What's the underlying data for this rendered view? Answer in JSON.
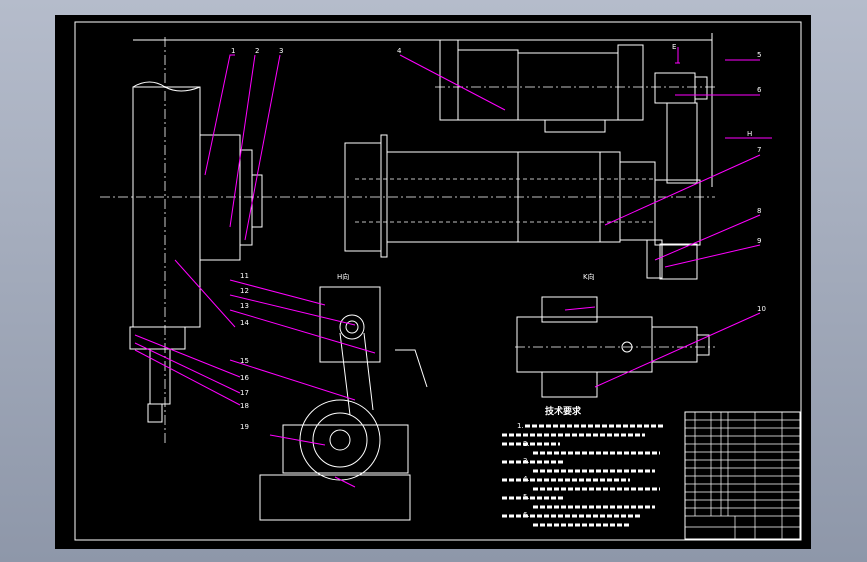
{
  "drawing": {
    "line_color": "#ffffff",
    "leader_color": "#ff00ff",
    "background": "#000000",
    "tech_title": "技术要求",
    "tech_items": [
      "1.",
      "2.",
      "3.",
      "4.",
      "5.",
      "6."
    ],
    "view_h": "H向",
    "view_k": "K向",
    "label_h": "H",
    "label_e": "E",
    "part_numbers": [
      "1",
      "2",
      "3",
      "4",
      "5",
      "6",
      "7",
      "8",
      "9",
      "10",
      "11",
      "12",
      "13",
      "14",
      "15",
      "16",
      "17",
      "18",
      "19"
    ]
  }
}
